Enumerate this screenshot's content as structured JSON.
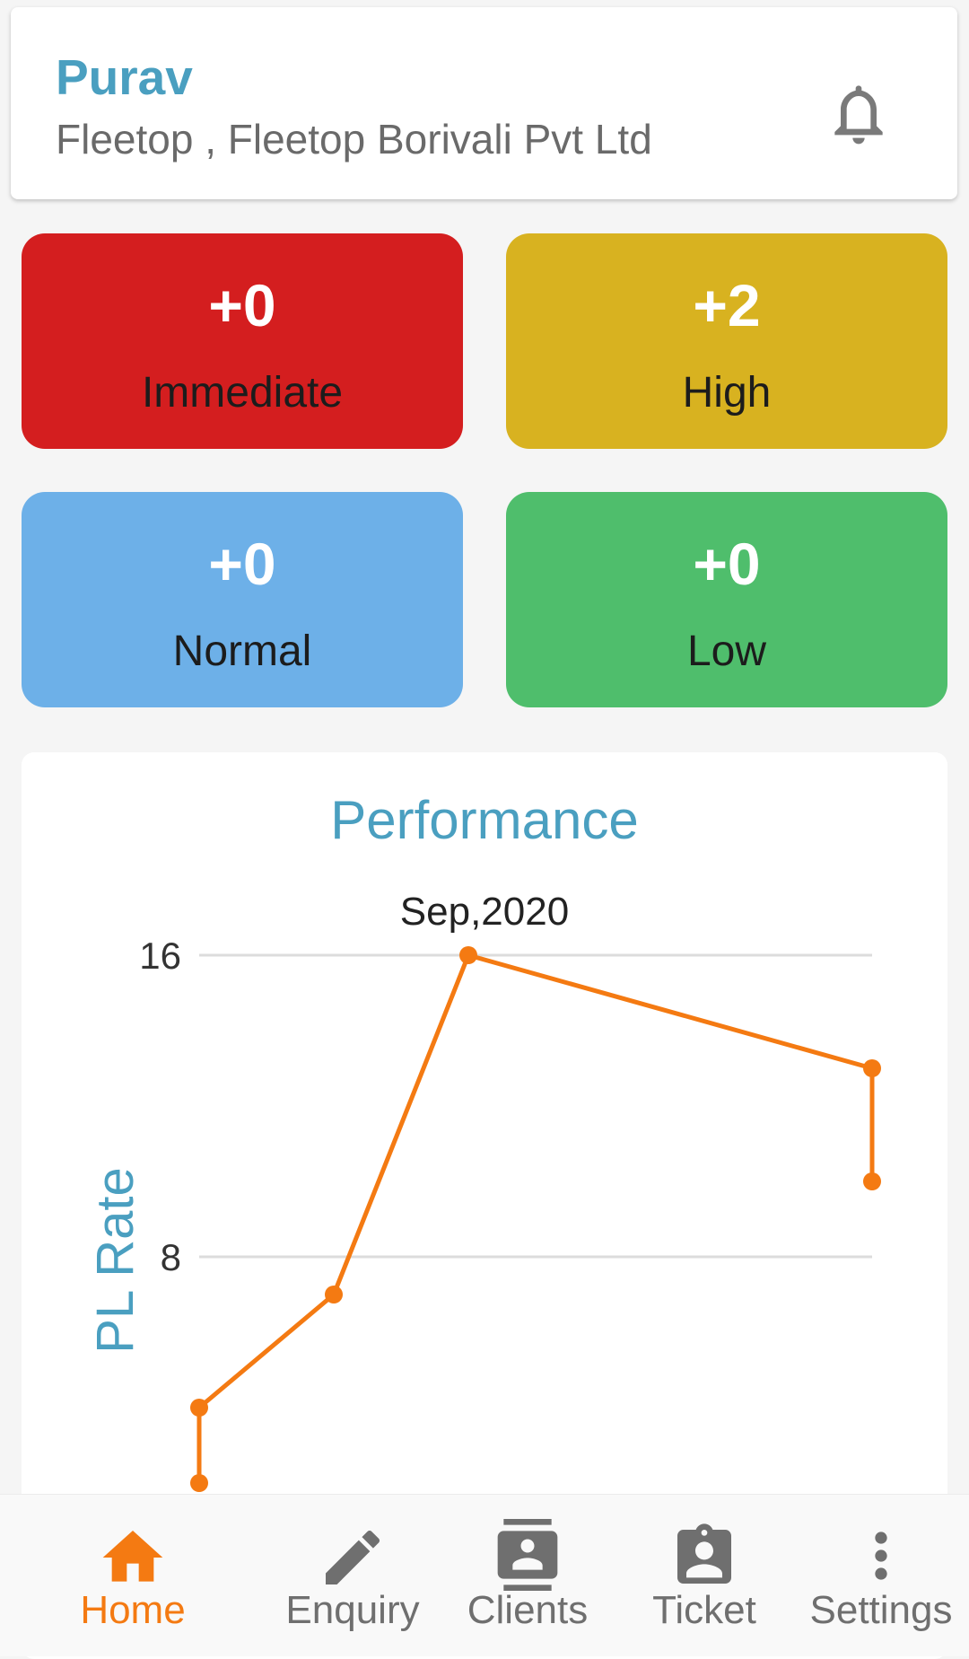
{
  "header": {
    "user_name": "Purav",
    "company": "Fleetop , Fleetop Borivali Pvt Ltd",
    "bell_icon": "bell-icon"
  },
  "priorities": [
    {
      "value": "+0",
      "label": "Immediate",
      "color": "#d41e1f"
    },
    {
      "value": "+2",
      "label": "High",
      "color": "#d8b220"
    },
    {
      "value": "+0",
      "label": "Normal",
      "color": "#6db0e8"
    },
    {
      "value": "+0",
      "label": "Low",
      "color": "#4fbe6c"
    }
  ],
  "chart_data": {
    "type": "line",
    "title": "Performance",
    "ylabel": "PL Rate",
    "y_ticks": [
      8,
      16
    ],
    "ylim": [
      0,
      16
    ],
    "grid": true,
    "annotation": "Sep,2020",
    "line_color": "#f47a12",
    "points": [
      {
        "x": 0,
        "y": 2
      },
      {
        "x": 0,
        "y": 4
      },
      {
        "x": 1,
        "y": 7
      },
      {
        "x": 2,
        "y": 16
      },
      {
        "x": 5,
        "y": 13
      },
      {
        "x": 5,
        "y": 10
      }
    ],
    "annotated_point_index": 3
  },
  "nav": {
    "active": "Home",
    "accent_color": "#f47a12",
    "items": [
      {
        "label": "Home",
        "icon": "home-icon"
      },
      {
        "label": "Enquiry",
        "icon": "pencil-icon"
      },
      {
        "label": "Clients",
        "icon": "contacts-icon"
      },
      {
        "label": "Ticket",
        "icon": "clipboard-account-icon"
      },
      {
        "label": "Settings",
        "icon": "more-vertical-icon"
      }
    ]
  }
}
